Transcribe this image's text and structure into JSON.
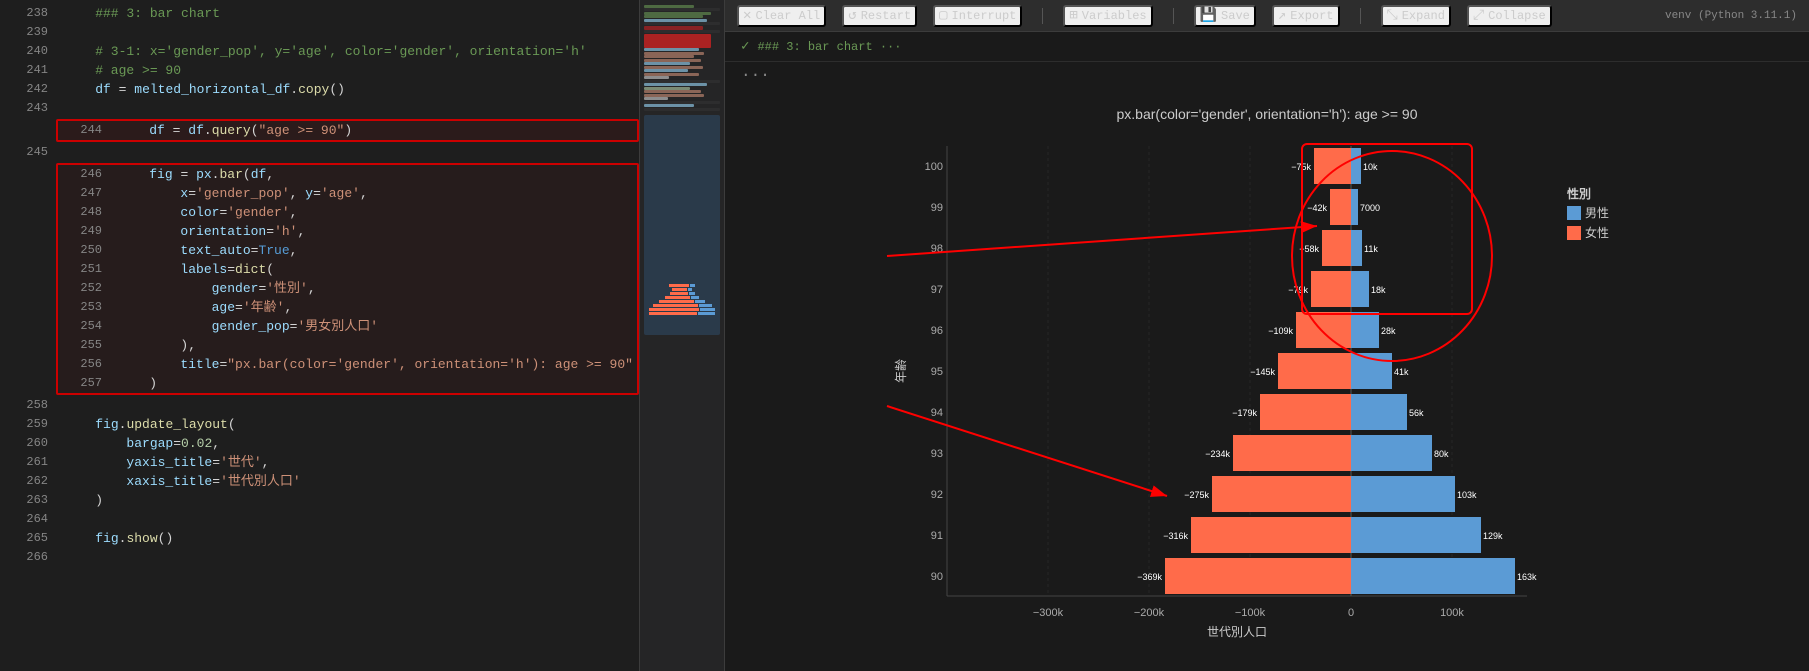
{
  "toolbar": {
    "clear_all": "Clear All",
    "restart": "Restart",
    "interrupt": "Interrupt",
    "variables": "Variables",
    "save": "Save",
    "export": "Export",
    "expand": "Expand",
    "collapse": "Collapse",
    "venv": "venv (Python 3.11.1)"
  },
  "cell_status": {
    "text": "### 3: bar chart ···"
  },
  "chart": {
    "title": "px.bar(color='gender', orientation='h'): age >= 90",
    "x_label": "世代別人口",
    "y_label": "年齢",
    "color_male": "#5b9bd5",
    "color_female": "#ff6b4a",
    "legend_title": "性別",
    "legend_male": "男性",
    "legend_female": "女性"
  },
  "code": {
    "lines": [
      {
        "num": "238",
        "content": "    ### 3: bar chart"
      },
      {
        "num": "239",
        "content": ""
      },
      {
        "num": "240",
        "content": "    # 3-1: x='gender_pop', y='age', color='gender', orientation='h'"
      },
      {
        "num": "241",
        "content": "    # age >= 90"
      },
      {
        "num": "242",
        "content": "    df = melted_horizontal_df.copy()"
      },
      {
        "num": "243",
        "content": ""
      },
      {
        "num": "244",
        "content": "    df = df.query(\"age >= 90\")"
      },
      {
        "num": "245",
        "content": ""
      },
      {
        "num": "246",
        "content": "    fig = px.bar(df,"
      },
      {
        "num": "247",
        "content": "        x='gender_pop', y='age',"
      },
      {
        "num": "248",
        "content": "        color='gender',"
      },
      {
        "num": "249",
        "content": "        orientation='h',"
      },
      {
        "num": "250",
        "content": "        text_auto=True,"
      },
      {
        "num": "251",
        "content": "        labels=dict("
      },
      {
        "num": "252",
        "content": "            gender='性別',"
      },
      {
        "num": "253",
        "content": "            age='年齢',"
      },
      {
        "num": "254",
        "content": "            gender_pop='男女別人口'"
      },
      {
        "num": "255",
        "content": "        ),"
      },
      {
        "num": "256",
        "content": "        title=\"px.bar(color='gender', orientation='h'): age >= 90\""
      },
      {
        "num": "257",
        "content": "    )"
      },
      {
        "num": "258",
        "content": ""
      },
      {
        "num": "259",
        "content": "    fig.update_layout("
      },
      {
        "num": "260",
        "content": "        bargap=0.02,"
      },
      {
        "num": "261",
        "content": "        yaxis_title='世代',"
      },
      {
        "num": "262",
        "content": "        xaxis_title='世代別人口'"
      },
      {
        "num": "263",
        "content": "    )"
      },
      {
        "num": "264",
        "content": ""
      },
      {
        "num": "265",
        "content": "    fig.show()"
      },
      {
        "num": "266",
        "content": ""
      }
    ]
  },
  "bar_data": [
    {
      "age": 100,
      "female": -75000,
      "male": 10000,
      "female_label": "-75k",
      "male_label": "10k"
    },
    {
      "age": 99,
      "female": -42000,
      "male": 7000,
      "female_label": "-42k",
      "male_label": "7000"
    },
    {
      "age": 98,
      "female": -58000,
      "male": 11000,
      "female_label": "-58k",
      "male_label": "11k"
    },
    {
      "age": 97,
      "female": -79000,
      "male": 18000,
      "female_label": "-79k",
      "male_label": "18k"
    },
    {
      "age": 96,
      "female": -109000,
      "male": 28000,
      "female_label": "-109k",
      "male_label": "28k"
    },
    {
      "age": 95,
      "female": -145000,
      "male": 41000,
      "female_label": "-145k",
      "male_label": "41k"
    },
    {
      "age": 94,
      "female": -179000,
      "male": 56000,
      "female_label": "-179k",
      "male_label": "56k"
    },
    {
      "age": 93,
      "female": -234000,
      "male": 80000,
      "female_label": "-234k",
      "male_label": "80k"
    },
    {
      "age": 92,
      "female": -275000,
      "male": 103000,
      "female_label": "-275k",
      "male_label": "103k"
    },
    {
      "age": 91,
      "female": -316000,
      "male": 129000,
      "female_label": "-316k",
      "male_label": "129k"
    },
    {
      "age": 90,
      "female": -369000,
      "male": 163000,
      "female_label": "-369k",
      "male_label": "163k"
    }
  ]
}
